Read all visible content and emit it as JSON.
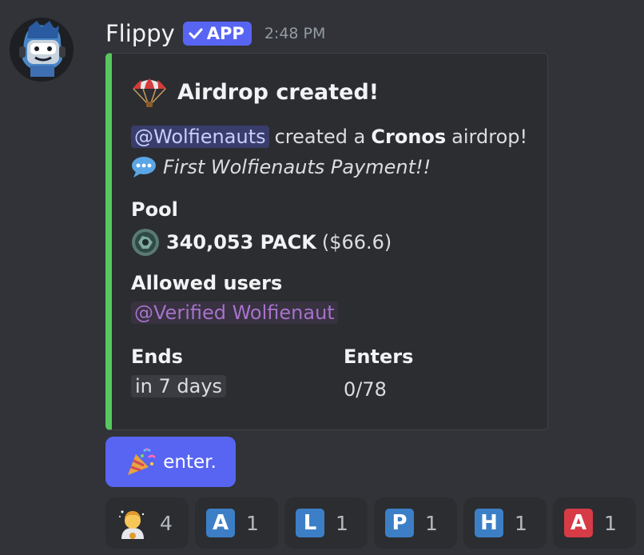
{
  "message": {
    "username": "Flippy",
    "badge": "APP",
    "timestamp": "2:48 PM"
  },
  "embed": {
    "accent_color": "#57c75f",
    "title": "Airdrop created!",
    "creator_mention": "@Wolfienauts",
    "created_a": "created a",
    "chain": "Cronos",
    "airdrop_word": "airdrop!",
    "note": "First Wolfienauts Payment!!",
    "pool_label": "Pool",
    "pool_amount": "340,053 PACK",
    "pool_value": "($66.6)",
    "allowed_label": "Allowed users",
    "allowed_role": "@Verified Wolfienaut",
    "ends_label": "Ends",
    "ends_value": "in 7 days",
    "enters_label": "Enters",
    "enters_value": "0/78"
  },
  "button": {
    "label": "enter.",
    "color": "#5865f2"
  },
  "reactions": [
    {
      "icon": "astronaut-emoji",
      "count": "4"
    },
    {
      "letter": "A",
      "color": "#3c7fc7",
      "count": "1"
    },
    {
      "letter": "L",
      "color": "#3c7fc7",
      "count": "1"
    },
    {
      "letter": "P",
      "color": "#3c7fc7",
      "count": "1"
    },
    {
      "letter": "H",
      "color": "#3c7fc7",
      "count": "1"
    },
    {
      "letter": "A",
      "color": "#d63b46",
      "count": "1"
    }
  ]
}
